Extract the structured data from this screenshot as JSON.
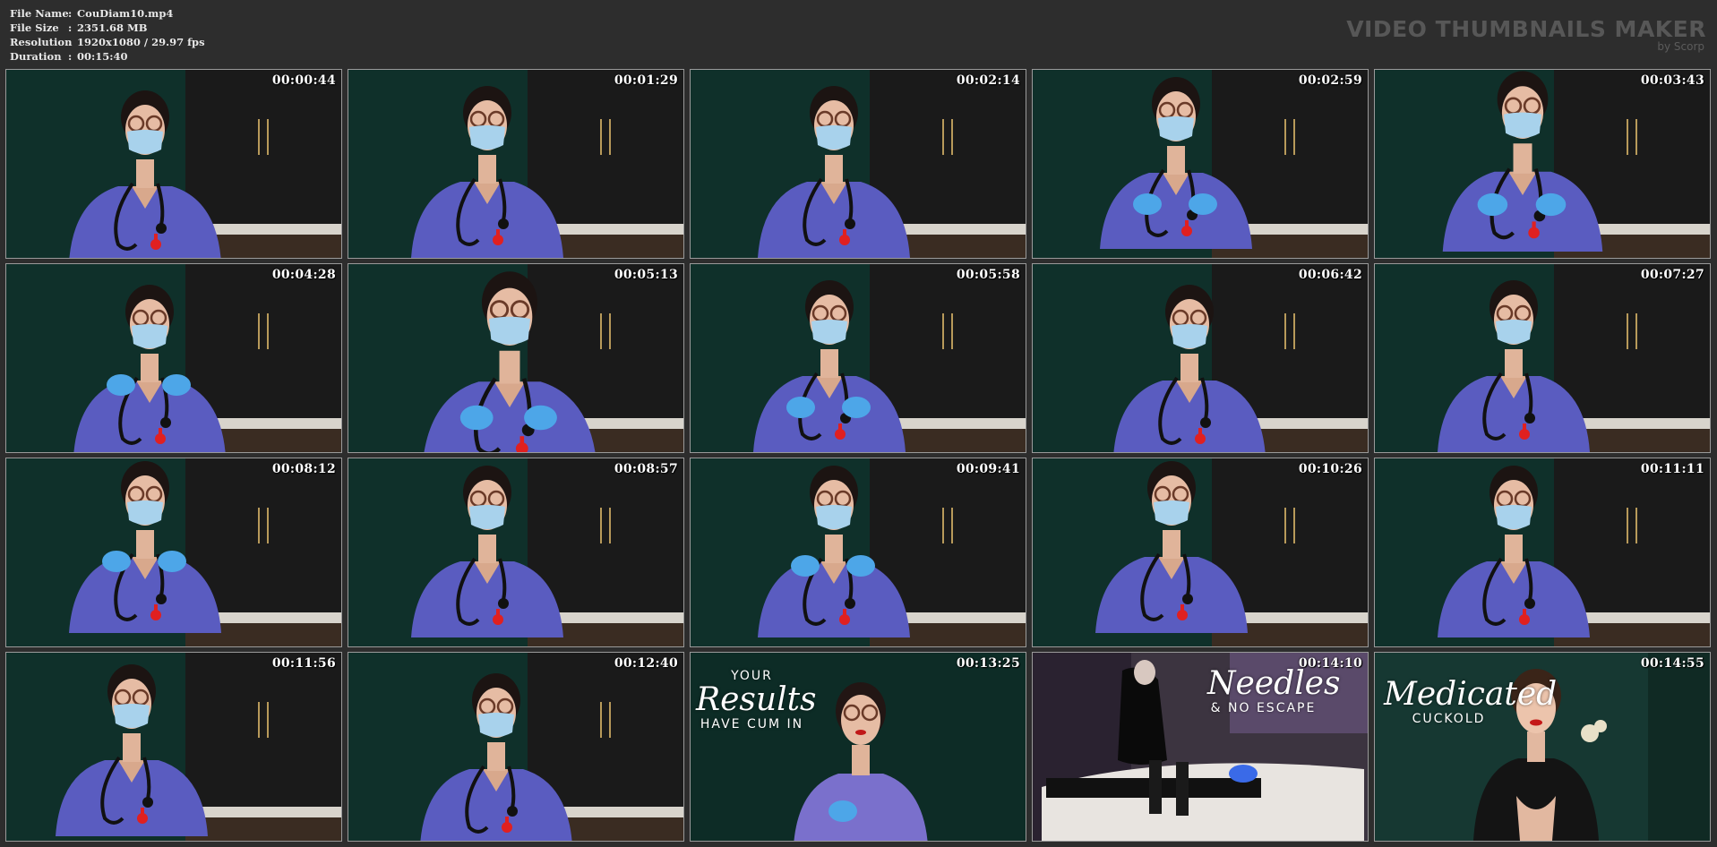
{
  "file_info": {
    "rows": [
      {
        "label": "File Name",
        "sep": ":",
        "value": "CouDiam10.mp4"
      },
      {
        "label": "File Size",
        "sep": ":",
        "value": "2351.68 MB"
      },
      {
        "label": "Resolution",
        "sep": ":",
        "value": "1920x1080 / 29.97 fps"
      },
      {
        "label": "Duration",
        "sep": ":",
        "value": "00:15:40"
      }
    ]
  },
  "brand": {
    "title": "VIDEO THUMBNAILS MAKER",
    "subtitle": "by Scorp"
  },
  "thumbnails": [
    {
      "time": "00:00:44"
    },
    {
      "time": "00:01:29"
    },
    {
      "time": "00:02:14"
    },
    {
      "time": "00:02:59"
    },
    {
      "time": "00:03:43"
    },
    {
      "time": "00:04:28"
    },
    {
      "time": "00:05:13"
    },
    {
      "time": "00:05:58"
    },
    {
      "time": "00:06:42"
    },
    {
      "time": "00:07:27"
    },
    {
      "time": "00:08:12"
    },
    {
      "time": "00:08:57"
    },
    {
      "time": "00:09:41"
    },
    {
      "time": "00:10:26"
    },
    {
      "time": "00:11:11"
    },
    {
      "time": "00:11:56"
    },
    {
      "time": "00:12:40"
    },
    {
      "time": "00:13:25",
      "overlay": {
        "line1": "YOUR",
        "line2": "Results",
        "line3": "HAVE CUM IN"
      }
    },
    {
      "time": "00:14:10",
      "overlay": {
        "line1": "Needles",
        "line2": "& NO ESCAPE"
      }
    },
    {
      "time": "00:14:55",
      "overlay": {
        "line1": "Medicated",
        "line2": "CUCKOLD"
      }
    }
  ]
}
